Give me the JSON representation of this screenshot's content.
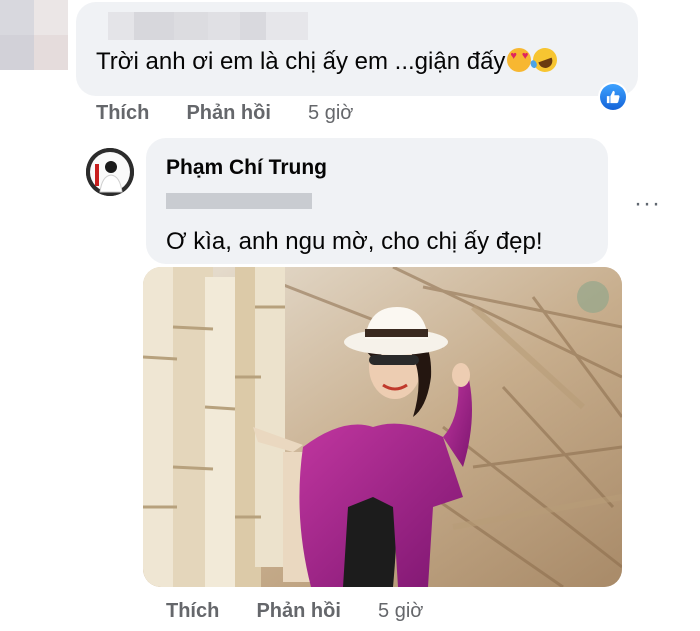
{
  "comment1": {
    "text": "Trời anh ơi em là chị ấy em ...giận đấy",
    "emojis": [
      "heart-eyes-emoji",
      "rofl-emoji"
    ],
    "actions": {
      "like": "Thích",
      "reply": "Phản hồi",
      "time": "5 giờ"
    },
    "reaction": "like-icon"
  },
  "comment2": {
    "author": "Phạm Chí Trung",
    "text": "Ơ kìa, anh ngu mờ, cho chị ấy đẹp!",
    "more": "···",
    "actions": {
      "like": "Thích",
      "reply": "Phản hồi",
      "time": "5 giờ"
    }
  },
  "colors": {
    "bubble": "#f0f2f5",
    "action_text": "#65676b",
    "like_blue": "#1877f2",
    "shirt_magenta": "#9b1f86"
  }
}
